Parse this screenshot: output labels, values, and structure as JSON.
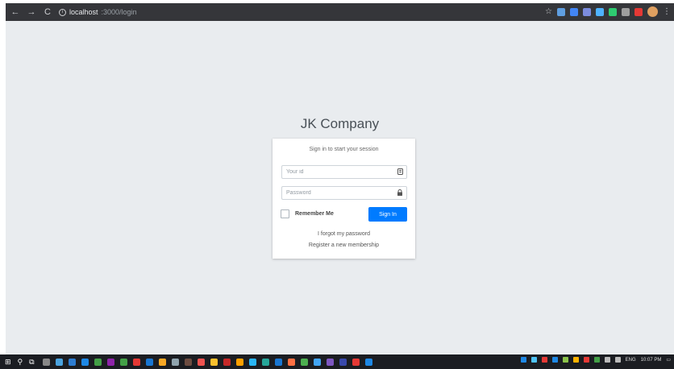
{
  "browser": {
    "url_host": "localhost",
    "url_path": ":3000/login",
    "nav": {
      "back": "←",
      "forward": "→",
      "reload": "C"
    },
    "extensions": [
      "#5f9ee0",
      "#4285f4",
      "#7b8cde",
      "#4fb3ff",
      "#2ecc71",
      "#9e9e9e",
      "#e53935"
    ],
    "star": "☆",
    "menu": "⋮"
  },
  "login": {
    "brand": "JK Company",
    "message": "Sign in to start your session",
    "id_placeholder": "Your id",
    "password_placeholder": "Password",
    "remember_label": "Remember Me",
    "signin_label": "Sign In",
    "forgot_link": "I forgot my password",
    "register_link": "Register a new membership",
    "accent": "#007bff"
  },
  "taskbar": {
    "start": "⊞",
    "search": "⚲",
    "taskview": "⧉",
    "apps": [
      "#888",
      "#4aa3df",
      "#2d7dd2",
      "#1e88e5",
      "#43a047",
      "#8e24aa",
      "#43a047",
      "#e53935",
      "#1976d2",
      "#f9a825",
      "#90a4ae",
      "#6d4c41",
      "#ef5350",
      "#fbc02d",
      "#c62828",
      "#ffa000",
      "#29b6f6",
      "#26a69a",
      "#1976d2",
      "#ff7043",
      "#4caf50",
      "#42a5f5",
      "#7e57c2",
      "#3949ab",
      "#e53935",
      "#1e88e5"
    ],
    "tray_icons": [
      "#1e88e5",
      "#4fc3f7",
      "#e53935",
      "#1e88e5",
      "#8bc34a",
      "#ffb300",
      "#e53935",
      "#43a047",
      "#bbb",
      "#bbb"
    ],
    "language": "ENG",
    "time": "10:07 PM"
  }
}
